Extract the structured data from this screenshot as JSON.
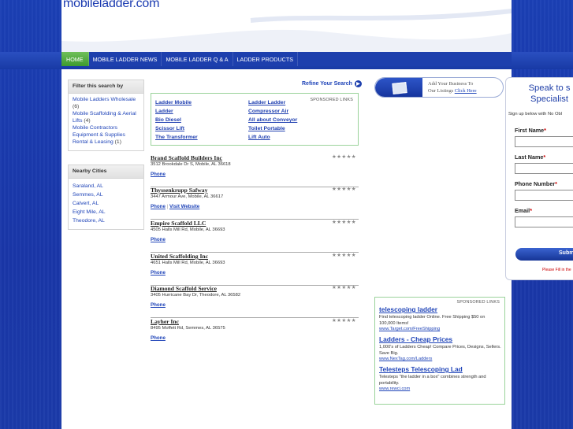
{
  "site": {
    "logo": "mobileladder.com"
  },
  "nav": {
    "items": [
      {
        "label": "HOME",
        "active": true
      },
      {
        "label": "MOBILE LADDER NEWS",
        "active": false
      },
      {
        "label": "MOBILE LADDER Q & A",
        "active": false
      },
      {
        "label": "LADDER PRODUCTS",
        "active": false
      }
    ]
  },
  "filter": {
    "title": "Filter this search by",
    "items": [
      {
        "label": "Mobile Ladders Wholesale",
        "count": "(6)"
      },
      {
        "label": "Mobile Scaffolding & Aerial Lifts",
        "count": "(4)"
      },
      {
        "label": "Mobile Contractors Equipment & Supplies Rental & Leasing",
        "count": "(1)"
      }
    ]
  },
  "cities": {
    "title": "Nearby Cities",
    "items": [
      "Saraland, AL",
      "Semmes, AL",
      "Calvert, AL",
      "Eight Mile, AL",
      "Theodore, AL"
    ]
  },
  "refine": {
    "label": "Refine Your Search",
    "arrow": "▶"
  },
  "sponsored_top": {
    "tag": "SPONSORED LINKS",
    "left": [
      "Ladder Mobile",
      "Ladder",
      "Bio Diesel",
      "Scissor Lift",
      "The Transformer"
    ],
    "right": [
      "Ladder Ladder",
      "Compressor Air",
      "All about Conveyor",
      "Toilet Portable",
      "Lift Auto"
    ]
  },
  "listings": [
    {
      "name": "Brand Scaffold Builders Inc",
      "address": "3512 Brookdale Dr S, Mobile, AL 36618",
      "links": [
        "Phone"
      ],
      "rating": "★★★★★"
    },
    {
      "name": "Thyssenkrupp Safway",
      "address": "3447 Armour Ave, Mobile, AL 36617",
      "links": [
        "Phone",
        "Visit Website"
      ],
      "rating": "★★★★★"
    },
    {
      "name": "Empire Scaffold LLC",
      "address": "4505 Halls Mill Rd, Mobile, AL 36693",
      "links": [
        "Phone"
      ],
      "rating": "★★★★★"
    },
    {
      "name": "United Scaffolding Inc",
      "address": "4651 Halls Mill Rd, Mobile, AL 36693",
      "links": [
        "Phone"
      ],
      "rating": "★★★★★"
    },
    {
      "name": "Diamond Scaffold Service",
      "address": "3405 Hurricane Bay Dr, Theodore, AL 36582",
      "links": [
        "Phone"
      ],
      "rating": "★★★★★"
    },
    {
      "name": "Layher Inc",
      "address": "8495 Moffett Rd, Semmes, AL 36575",
      "links": [
        "Phone"
      ],
      "rating": "★★★★★"
    }
  ],
  "add_business": {
    "line1": "Add Your Business To",
    "line2_prefix": "Our Listings",
    "line2_link": "Click Here"
  },
  "sponsored_right": {
    "tag": "SPONSORED LINKS",
    "ads": [
      {
        "title": "telescoping ladder",
        "desc": "Find telescoping ladder Online. Free Shipping $50 on 100,000 Items!",
        "url": "www.Target.com/FreeShipping"
      },
      {
        "title": "Ladders - Cheap Prices",
        "desc": "1,000's of Ladders Cheap! Compare Prices, Designs, Sellers. Save Big.",
        "url": "www.NexTag.com/Ladders"
      },
      {
        "title": "Telesteps Telescoping Lad",
        "desc": "Telesteps \"the ladder in a box\" combines strength and portability.",
        "url": "www.rewci.com"
      }
    ]
  },
  "speak_form": {
    "heading_line1": "Speak to s",
    "heading_line2": "Specialist",
    "sub": "Sign up below with No Obl",
    "fields": [
      {
        "label": "First Name",
        "required": "*",
        "value": ""
      },
      {
        "label": "Last Name",
        "required": "*",
        "value": ""
      },
      {
        "label": "Phone Number",
        "required": "*",
        "value": ""
      },
      {
        "label": "Email",
        "required": "*",
        "value": ""
      }
    ],
    "submit": "Subm",
    "note": "Please Fill in the"
  },
  "colors": {
    "brand_blue": "#1d3fad",
    "nav_active": "#4aa83a",
    "sponsor_border": "#9ad39a"
  }
}
